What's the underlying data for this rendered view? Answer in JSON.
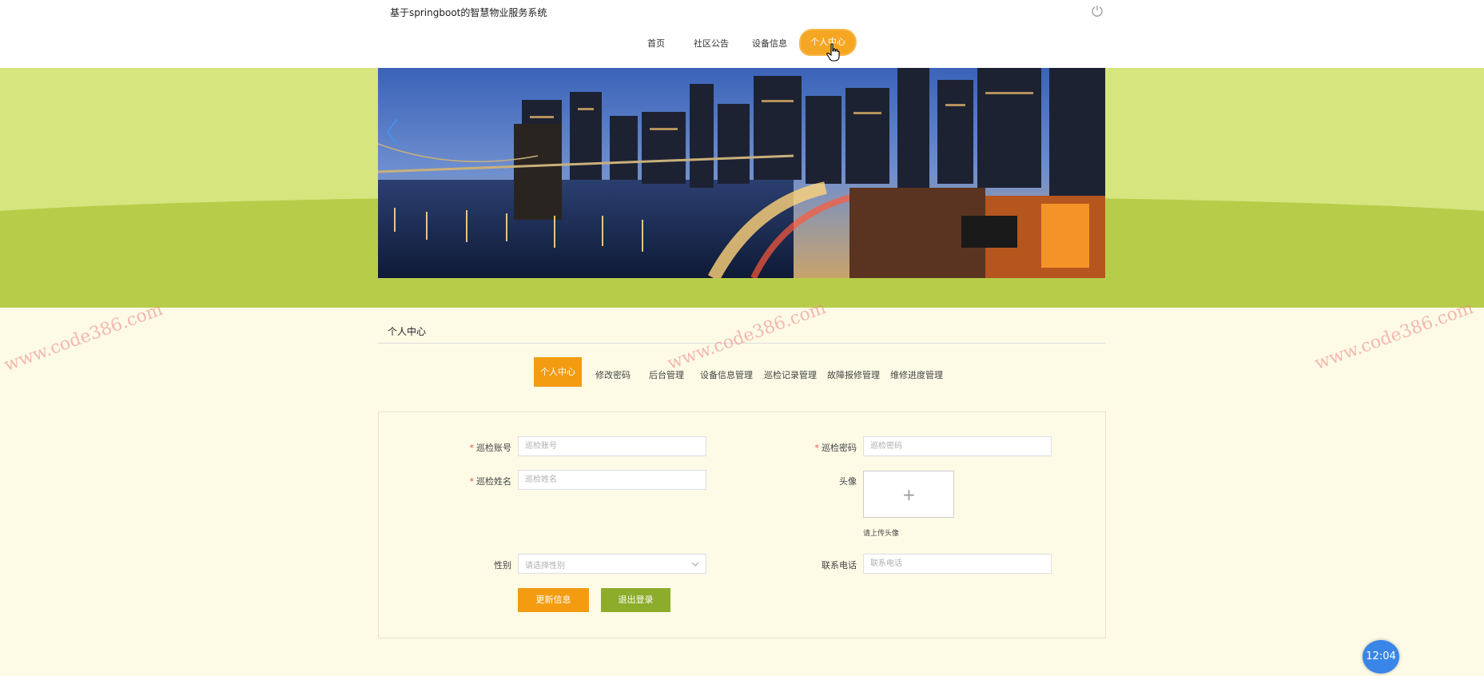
{
  "header": {
    "title": "基于springboot的智慧物业服务系统",
    "nav": [
      {
        "label": "首页"
      },
      {
        "label": "社区公告"
      },
      {
        "label": "设备信息"
      },
      {
        "label": "个人中心"
      }
    ]
  },
  "section": {
    "title": "个人中心"
  },
  "tabs": [
    {
      "label": "个人中心"
    },
    {
      "label": "修改密码"
    },
    {
      "label": "后台管理"
    },
    {
      "label": "设备信息管理"
    },
    {
      "label": "巡检记录管理"
    },
    {
      "label": "故障报修管理"
    },
    {
      "label": "维修进度管理"
    }
  ],
  "form": {
    "account": {
      "label": "巡检账号",
      "placeholder": "巡检账号"
    },
    "password": {
      "label": "巡检密码",
      "placeholder": "巡检密码"
    },
    "name": {
      "label": "巡检姓名",
      "placeholder": "巡检姓名"
    },
    "avatar": {
      "label": "头像",
      "hint": "请上传头像"
    },
    "gender": {
      "label": "性别",
      "placeholder": "请选择性别"
    },
    "phone": {
      "label": "联系电话",
      "placeholder": "联系电话"
    },
    "update_button": "更新信息",
    "logout_button": "退出登录"
  },
  "watermark": "www.code386.com",
  "clock": "12:04"
}
